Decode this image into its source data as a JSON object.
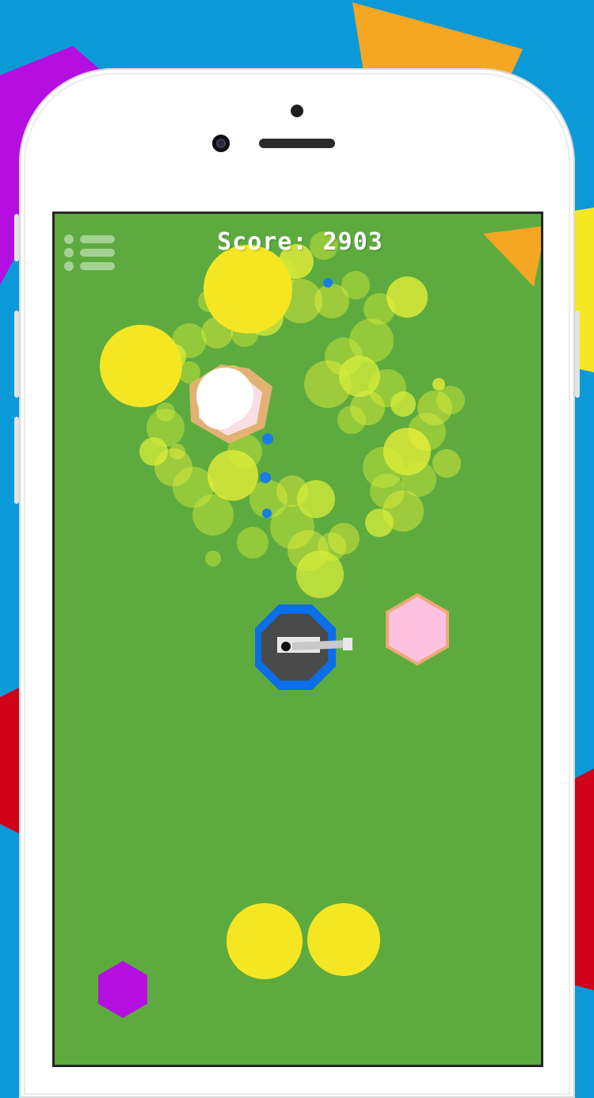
{
  "hud": {
    "score_label": "Score: 2903",
    "menu_icon": "menu-list-icon"
  },
  "colors": {
    "sky": "#0b9ad8",
    "field": "#5dab3f",
    "yellow": "#f5e623",
    "pale_yellow": "#d8ee3a",
    "purple": "#b40fe0",
    "orange": "#f5a623",
    "red": "#d0021b",
    "blue_bullet": "#1a7ce6",
    "player_ring": "#0c6ee8",
    "player_body": "#4a4a4a",
    "pink_hexagon": "#fdc2e0"
  },
  "game": {
    "score": 2903,
    "player_turret": "tank-octagon",
    "enemies": [
      "yellow-circle",
      "yellow-circle",
      "yellow-circle",
      "yellow-circle",
      "pink-hexagon",
      "purple-hexagon",
      "orange-triangle"
    ]
  }
}
